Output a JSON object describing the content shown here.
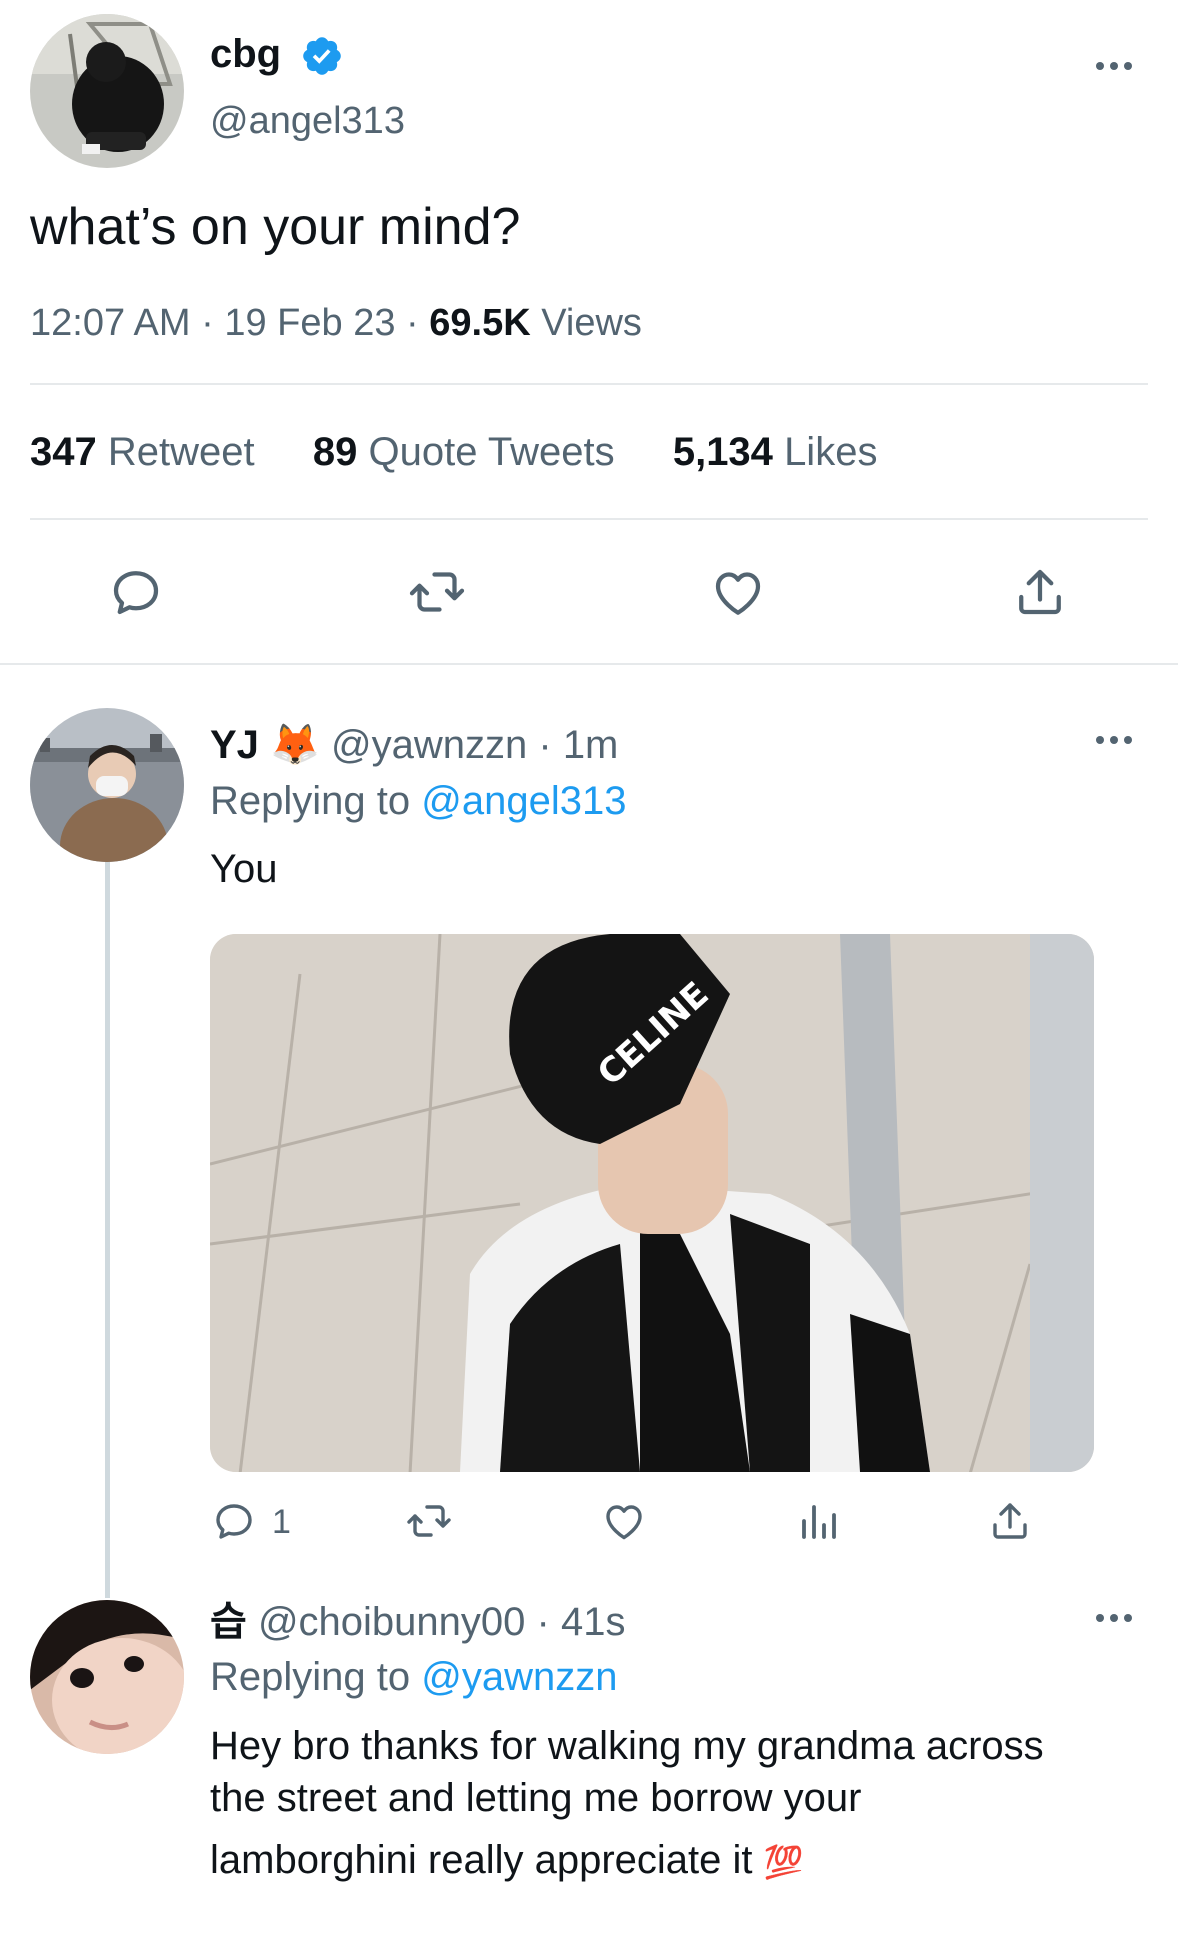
{
  "main_tweet": {
    "display_name": "cbg",
    "handle": "@angel313",
    "text": "what’s on your mind?",
    "time": "12:07 AM",
    "sep": "·",
    "date": "19 Feb 23",
    "views_count": "69.5K",
    "views_label": "Views",
    "stats": {
      "retweets_count": "347",
      "retweets_label": "Retweet",
      "quotes_count": "89",
      "quotes_label": "Quote Tweets",
      "likes_count": "5,134",
      "likes_label": "Likes"
    }
  },
  "reply1": {
    "display_name": "YJ",
    "emoji": "🦊",
    "handle": "@yawnzzn",
    "sep": "·",
    "time": "1m",
    "replying_prefix": "Replying to",
    "replying_handle": "@angel313",
    "text": "You",
    "photo_text": "CELINE",
    "reply_count": "1"
  },
  "reply2": {
    "display_name": "습",
    "handle": "@choibunny00",
    "sep": "·",
    "time": "41s",
    "replying_prefix": "Replying to",
    "replying_handle": "@yawnzzn",
    "text_line1": "Hey bro thanks for walking my grandma across",
    "text_line2": "the street and letting me borrow your",
    "text_line3": "lamborghini really appreciate it",
    "emoji": "💯"
  },
  "colors": {
    "accent": "#1d9bf0",
    "secondary_text": "#536471",
    "divider": "#e6e9eb",
    "verified": "#1d9bf0"
  },
  "icons": [
    "verified-badge-icon",
    "more-icon",
    "reply-icon",
    "retweet-icon",
    "like-icon",
    "share-icon",
    "analytics-icon"
  ]
}
